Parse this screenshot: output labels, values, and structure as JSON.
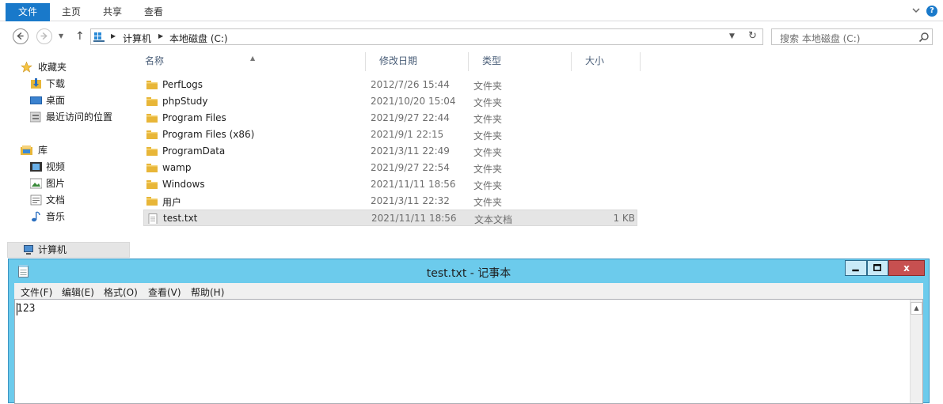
{
  "ribbon": {
    "tabs": [
      "文件",
      "主页",
      "共享",
      "查看"
    ]
  },
  "address": {
    "crumbs": [
      "计算机",
      "本地磁盘 (C:)"
    ]
  },
  "search": {
    "placeholder": "搜索 本地磁盘 (C:)"
  },
  "navpane": {
    "favorites": {
      "label": "收藏夹",
      "items": [
        "下载",
        "桌面",
        "最近访问的位置"
      ]
    },
    "libraries": {
      "label": "库",
      "items": [
        "视频",
        "图片",
        "文档",
        "音乐"
      ]
    },
    "computer": "计算机"
  },
  "filelist": {
    "columns": [
      "名称",
      "修改日期",
      "类型",
      "大小"
    ],
    "rows": [
      {
        "name": "PerfLogs",
        "date": "2012/7/26 15:44",
        "type": "文件夹",
        "size": ""
      },
      {
        "name": "phpStudy",
        "date": "2021/10/20 15:04",
        "type": "文件夹",
        "size": ""
      },
      {
        "name": "Program Files",
        "date": "2021/9/27 22:44",
        "type": "文件夹",
        "size": ""
      },
      {
        "name": "Program Files (x86)",
        "date": "2021/9/1 22:15",
        "type": "文件夹",
        "size": ""
      },
      {
        "name": "ProgramData",
        "date": "2021/3/11 22:49",
        "type": "文件夹",
        "size": ""
      },
      {
        "name": "wamp",
        "date": "2021/9/27 22:54",
        "type": "文件夹",
        "size": ""
      },
      {
        "name": "Windows",
        "date": "2021/11/11 18:56",
        "type": "文件夹",
        "size": ""
      },
      {
        "name": "用户",
        "date": "2021/3/11 22:32",
        "type": "文件夹",
        "size": ""
      },
      {
        "name": "test.txt",
        "date": "2021/11/11 18:56",
        "type": "文本文档",
        "size": "1 KB"
      }
    ]
  },
  "notepad": {
    "title": "test.txt - 记事本",
    "menu": [
      "文件(F)",
      "编辑(E)",
      "格式(O)",
      "查看(V)",
      "帮助(H)"
    ],
    "content": "123",
    "close_label": "x"
  },
  "colors": {
    "accent": "#1979ca",
    "folder": "#e8b638",
    "notepad_frame": "#6ccbec",
    "close": "#c75050"
  }
}
